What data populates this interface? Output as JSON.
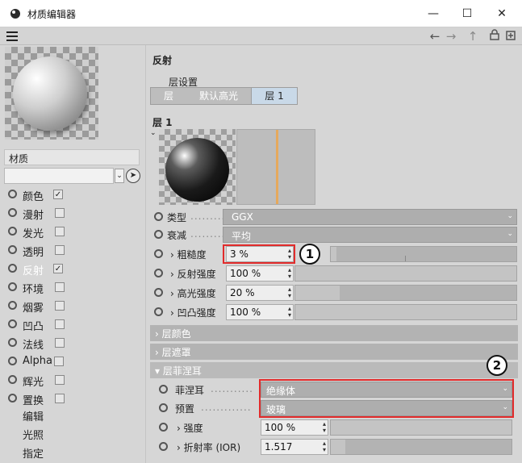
{
  "window": {
    "title": "材质编辑器",
    "minimize": "—",
    "maximize": "☐",
    "close": "✕"
  },
  "toolbar": {
    "back": "←",
    "forward": "→",
    "up": "↑",
    "lock": "🔒",
    "new": "⊞"
  },
  "material": {
    "name": "材质",
    "channels": [
      {
        "label": "颜色",
        "checked": true,
        "mark": "✓"
      },
      {
        "label": "漫射",
        "checked": false,
        "mark": ""
      },
      {
        "label": "发光",
        "checked": false,
        "mark": ""
      },
      {
        "label": "透明",
        "checked": false,
        "mark": ""
      },
      {
        "label": "反射",
        "checked": true,
        "mark": "✓",
        "active": true
      },
      {
        "label": "环境",
        "checked": false,
        "mark": ""
      },
      {
        "label": "烟雾",
        "checked": false,
        "mark": ""
      },
      {
        "label": "凹凸",
        "checked": false,
        "mark": ""
      },
      {
        "label": "法线",
        "checked": false,
        "mark": ""
      },
      {
        "label": "Alpha",
        "checked": false,
        "mark": ""
      },
      {
        "label": "辉光",
        "checked": false,
        "mark": ""
      },
      {
        "label": "置换",
        "checked": false,
        "mark": ""
      }
    ],
    "extra_items": [
      "编辑",
      "光照",
      "指定"
    ]
  },
  "reflection": {
    "title": "反射",
    "layer_settings": "层设置",
    "tabs": [
      "层",
      "默认高光",
      "层 1"
    ],
    "layer_title": "层 1",
    "type": {
      "label": "类型",
      "value": "GGX"
    },
    "attenuation": {
      "label": "衰减",
      "value": "平均"
    },
    "roughness": {
      "label": "粗糙度",
      "value": "3 %",
      "level": 0.03
    },
    "reflect_strength": {
      "label": "反射强度",
      "value": "100 %",
      "level": 1.0
    },
    "specular_strength": {
      "label": "高光强度",
      "value": "20 %",
      "level": 0.2
    },
    "bump_strength": {
      "label": "凹凸强度",
      "value": "100 %",
      "level": 1.0
    },
    "group_color": "层颜色",
    "group_mask": "层遮罩",
    "group_fresnel": "层菲涅耳",
    "fresnel": {
      "label": "菲涅耳",
      "value": "绝缘体"
    },
    "preset": {
      "label": "预置",
      "value": "玻璃"
    },
    "strength": {
      "label": "强度",
      "value": "100 %",
      "level": 1.0
    },
    "ior": {
      "label": "折射率 (IOR)",
      "value": "1.517",
      "level": 0.08
    }
  },
  "callouts": [
    "1",
    "2"
  ]
}
